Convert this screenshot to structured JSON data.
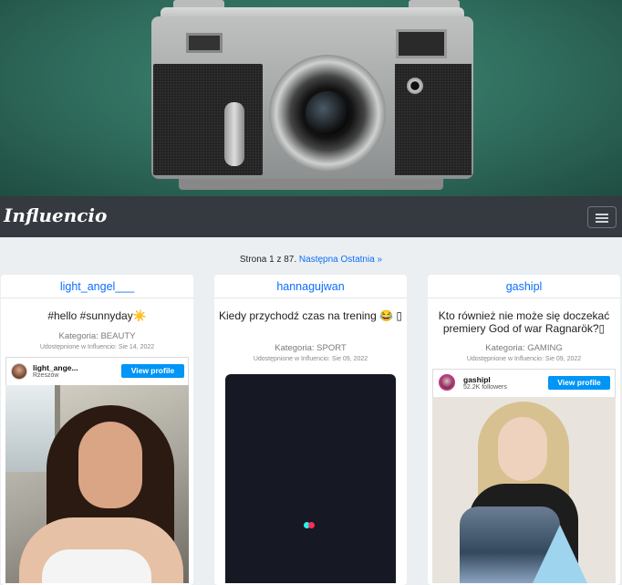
{
  "brand": "Influencio",
  "pagination": {
    "prefix": "Strona 1 z 87.",
    "next": "Następna",
    "last": "Ostatnia »"
  },
  "cards": [
    {
      "username": "light_angel___",
      "text": "#hello #sunnyday☀️",
      "category": "Kategoria: BEAUTY",
      "date": "Udostępnione w Influencio: Sie 14, 2022",
      "embed": {
        "name": "light_ange...",
        "sub": "Rzeszów",
        "button": "View profile"
      }
    },
    {
      "username": "hannagujwan",
      "text": "Kiedy przychodź czas na trening 😂 ▯",
      "category": "Kategoria: SPORT",
      "date": "Udostępnione w Influencio: Sie 09, 2022"
    },
    {
      "username": "gashipl",
      "text": "Kto również nie może się doczekać premiery God of war Ragnarök?▯",
      "category": "Kategoria: GAMING",
      "date": "Udostępnione w Influencio: Sie 09, 2022",
      "embed": {
        "name": "gashipl",
        "sub": "52.2K followers",
        "button": "View profile"
      }
    }
  ],
  "icons": {
    "menu": "hamburger-menu-icon"
  }
}
